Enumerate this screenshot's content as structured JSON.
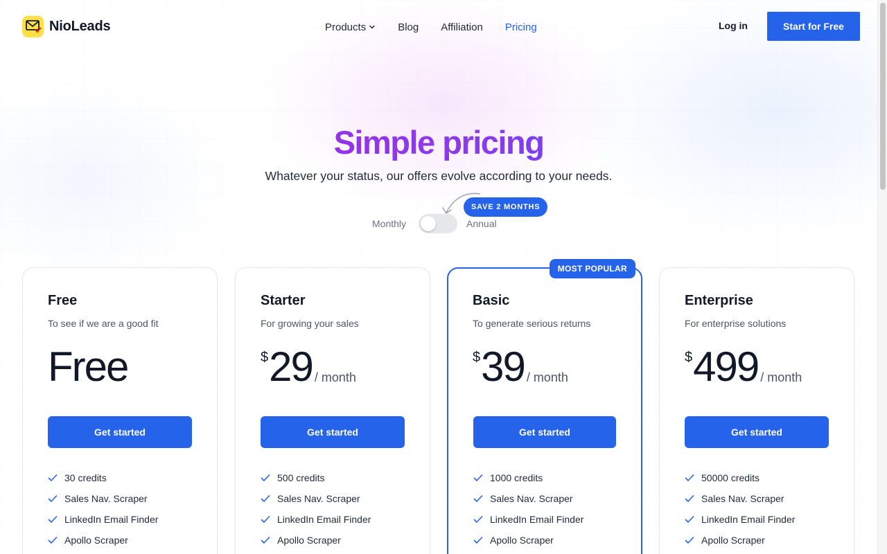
{
  "header": {
    "brand": "NioLeads",
    "nav": [
      {
        "label": "Products",
        "has_dropdown": true
      },
      {
        "label": "Blog"
      },
      {
        "label": "Affiliation"
      },
      {
        "label": "Pricing",
        "active": true
      }
    ],
    "login_label": "Log in",
    "cta_label": "Start for Free"
  },
  "hero": {
    "title": "Simple pricing",
    "subtitle": "Whatever your status, our offers evolve according to your needs.",
    "billing": {
      "monthly_label": "Monthly",
      "annual_label": "Annual",
      "save_badge": "SAVE 2 MONTHS",
      "annual_selected": false
    }
  },
  "plans": [
    {
      "name": "Free",
      "description": "To see if we are a good fit",
      "price_text": "Free",
      "button_label": "Get started",
      "features": [
        "30 credits",
        "Sales Nav. Scraper",
        "LinkedIn Email Finder",
        "Apollo Scraper"
      ]
    },
    {
      "name": "Starter",
      "description": "For growing your sales",
      "currency": "$",
      "amount": "29",
      "period": "/ month",
      "button_label": "Get started",
      "features": [
        "500 credits",
        "Sales Nav. Scraper",
        "LinkedIn Email Finder",
        "Apollo Scraper"
      ]
    },
    {
      "name": "Basic",
      "description": "To generate serious returns",
      "currency": "$",
      "amount": "39",
      "period": "/ month",
      "badge": "MOST POPULAR",
      "button_label": "Get started",
      "features": [
        "1000 credits",
        "Sales Nav. Scraper",
        "LinkedIn Email Finder",
        "Apollo Scraper"
      ]
    },
    {
      "name": "Enterprise",
      "description": "For enterprise solutions",
      "currency": "$",
      "amount": "499",
      "period": "/ month",
      "button_label": "Get started",
      "features": [
        "50000 credits",
        "Sales Nav. Scraper",
        "LinkedIn Email Finder",
        "Apollo Scraper"
      ]
    }
  ],
  "colors": {
    "accent": "#2563eb",
    "title_gradient_start": "#9333ea",
    "title_gradient_end": "#7e3ff0",
    "logo_bg": "#fde047"
  },
  "icons": {
    "logo": "envelope-check-icon",
    "dropdown": "chevron-down-icon",
    "feature": "check-icon",
    "annotation": "curved-arrow-icon"
  }
}
